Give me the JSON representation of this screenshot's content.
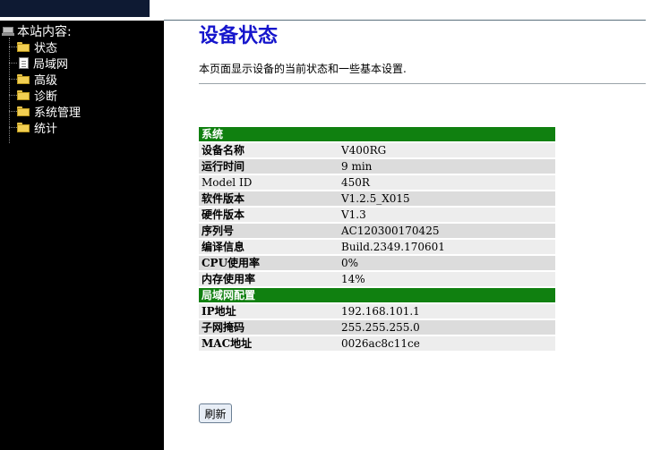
{
  "colors": {
    "sidebar_bg": "#000000",
    "top_banner": "#0e1a33",
    "title": "#1515cc",
    "section_header": "#108010"
  },
  "sidebar": {
    "root_label": "本站内容:",
    "items": [
      {
        "label": "状态",
        "icon": "folder-icon"
      },
      {
        "label": "局域网",
        "icon": "document-icon"
      },
      {
        "label": "高级",
        "icon": "folder-icon"
      },
      {
        "label": "诊断",
        "icon": "folder-icon"
      },
      {
        "label": "系统管理",
        "icon": "folder-icon"
      },
      {
        "label": "统计",
        "icon": "folder-icon"
      }
    ]
  },
  "page": {
    "title": "设备状态",
    "description": "本页面显示设备的当前状态和一些基本设置."
  },
  "system": {
    "header": "系统",
    "rows": [
      {
        "key": "设备名称",
        "value": "V400RG"
      },
      {
        "key": "运行时间",
        "value": "9 min"
      },
      {
        "key": "Model ID",
        "value": "450R"
      },
      {
        "key": "软件版本",
        "value": "V1.2.5_X015"
      },
      {
        "key": "硬件版本",
        "value": "V1.3"
      },
      {
        "key": "序列号",
        "value": "AC120300170425"
      },
      {
        "key": "编译信息",
        "value": "Build.2349.170601"
      },
      {
        "key": "CPU使用率",
        "value": "0%"
      },
      {
        "key": "内存使用率",
        "value": "14%"
      }
    ]
  },
  "lan": {
    "header": "局域网配置",
    "rows": [
      {
        "key": "IP地址",
        "value": "192.168.101.1"
      },
      {
        "key": "子网掩码",
        "value": "255.255.255.0"
      },
      {
        "key": "MAC地址",
        "value": "0026ac8c11ce"
      }
    ]
  },
  "buttons": {
    "refresh_label": "刷新"
  }
}
